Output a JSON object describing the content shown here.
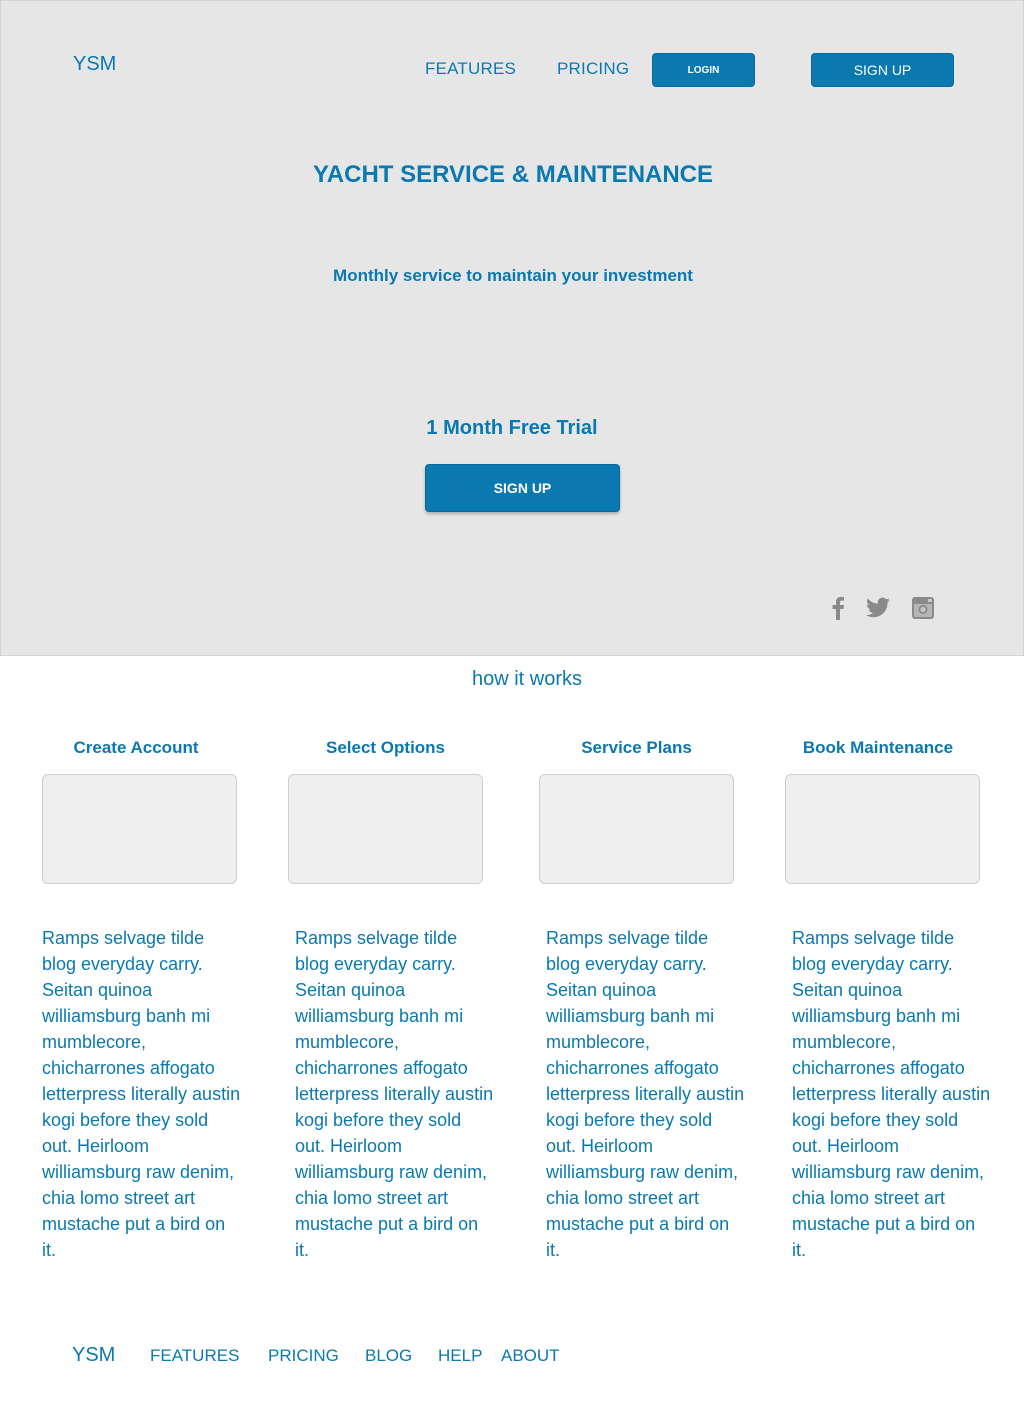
{
  "header": {
    "logo": "YSM",
    "nav": {
      "features": "FEATURES",
      "pricing": "PRICING"
    },
    "login_label": "LOGIN",
    "signup_label": "SIGN UP"
  },
  "hero": {
    "title": "YACHT SERVICE & MAINTENANCE",
    "subtitle": "Monthly service to maintain your investment",
    "trial": "1 Month Free Trial",
    "cta_label": "SIGN UP",
    "social": [
      "facebook-icon",
      "twitter-icon",
      "instagram-icon"
    ]
  },
  "how_it_works": {
    "heading": "how it works",
    "steps": [
      {
        "title": "Create Account",
        "body": "Ramps selvage tilde blog everyday carry. Seitan quinoa williamsburg banh mi mumblecore, chicharrones affogato letterpress literally austin kogi before they sold out. Heirloom williamsburg raw denim, chia lomo street art mustache put a bird on it."
      },
      {
        "title": "Select Options",
        "body": "Ramps selvage tilde blog everyday carry. Seitan quinoa williamsburg banh mi mumblecore, chicharrones affogato letterpress literally austin kogi before they sold out. Heirloom williamsburg raw denim, chia lomo street art mustache put a bird on it."
      },
      {
        "title": "Service Plans",
        "body": "Ramps selvage tilde blog everyday carry. Seitan quinoa williamsburg banh mi mumblecore, chicharrones affogato letterpress literally austin kogi before they sold out. Heirloom williamsburg raw denim, chia lomo street art mustache put a bird on it."
      },
      {
        "title": "Book Maintenance",
        "body": "Ramps selvage tilde blog everyday carry. Seitan quinoa williamsburg banh mi mumblecore, chicharrones affogato letterpress literally austin kogi before they sold out. Heirloom williamsburg raw denim, chia lomo street art mustache put a bird on it."
      }
    ]
  },
  "footer": {
    "logo": "YSM",
    "links": [
      "FEATURES",
      "PRICING",
      "BLOG",
      "HELP",
      "ABOUT"
    ]
  },
  "colors": {
    "accent": "#0a79b0",
    "hero_bg": "#e6e6e6",
    "icon_gray": "#8a8a8a"
  }
}
